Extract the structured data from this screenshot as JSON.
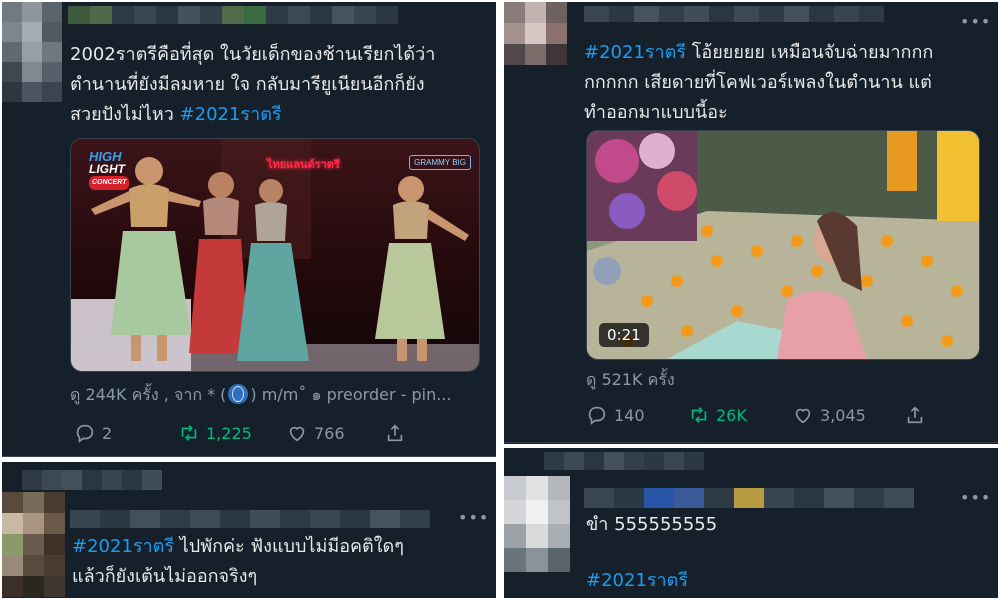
{
  "tweets": {
    "top_left": {
      "text_line1": "2002ราตรีคือที่สุด ในวัยเด็กของช้านเรียกได้ว่า",
      "text_line2": "ตำนานที่ยังมีลมหาย ใจ กลับมารียูเนียนอีกก็ยัง",
      "text_line3_prefix": "สวยปังไม่ไหว ",
      "hashtag": "#2021ราตรี",
      "media": {
        "logo_high": "HIGH",
        "logo_light": "LIGHT",
        "logo_concert": "CONCERT",
        "stage_sign": "ไทยแลนด์ราตรี",
        "watermark": "GRAMMY BIG"
      },
      "views_prefix": "ดู 244K ครั้ง , จาก * (",
      "views_suffix": ") m/m˚ ๑ preorder - pin...",
      "replies": "2",
      "retweets": "1,225",
      "likes": "766"
    },
    "top_right": {
      "hashtag": "#2021ราตรี",
      "text_line1_suffix": " โอ้ยยยยย เหมือนจับฉ่ายมากกก",
      "text_line2": "กกกกก เสียดายที่โคฟเวอร์เพลงในตำนาน แต่",
      "text_line3": "ทำออกมาแบบนี้อะ",
      "video_duration": "0:21",
      "views": "ดู 521K ครั้ง",
      "replies": "140",
      "retweets": "26K",
      "likes": "3,045"
    },
    "bottom_left": {
      "hashtag": "#2021ราตรี",
      "text_line1_suffix": " ไปพักค่ะ ฟังแบบไม่มีอคติใดๆ",
      "text_line2": "แล้วก็ยังเต้นไม่ออกจริงๆ"
    },
    "bottom_right": {
      "text_line1": "ขำ 555555555",
      "hashtag": "#2021ราตรี"
    }
  },
  "more_label": "•••",
  "colors": {
    "background": "#15202b",
    "text": "#e7e9ea",
    "hashtag": "#1d9bf0",
    "muted": "#8b98a5",
    "retweet_active": "#00ba7c",
    "divider": "#38444d"
  },
  "icons": [
    "reply-icon",
    "retweet-icon",
    "like-icon",
    "share-icon",
    "globe-icon",
    "more-icon"
  ]
}
